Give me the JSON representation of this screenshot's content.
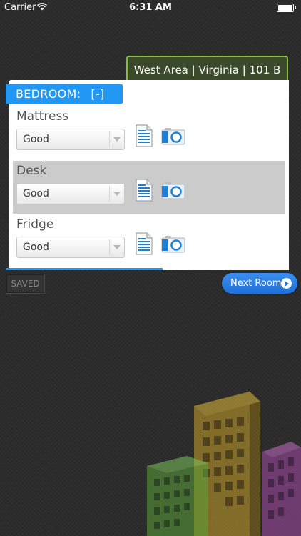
{
  "status_bar": {
    "carrier": "Carrier",
    "time": "6:31 AM"
  },
  "location": {
    "label": "West Area | Virginia | 101 B"
  },
  "room": {
    "name": "BEDROOM:",
    "toggle": "[-]"
  },
  "items": [
    {
      "label": "Mattress",
      "condition": "Good"
    },
    {
      "label": "Desk",
      "condition": "Good"
    },
    {
      "label": "Fridge",
      "condition": "Good"
    }
  ],
  "actions": {
    "saved": "SAVED",
    "next": "Next Room"
  },
  "colors": {
    "accent": "#2196f3",
    "location_border": "#84bf3a",
    "background": "#2c2c2c"
  }
}
